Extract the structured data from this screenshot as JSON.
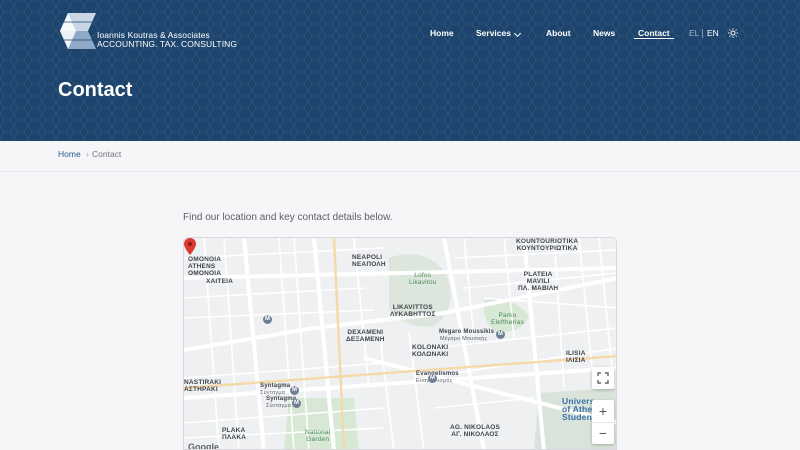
{
  "brand": {
    "name_line1": "Ioannis Koutras & Associates",
    "name_line2": "ACCOUNTING. TAX. CONSULTING"
  },
  "nav": {
    "items": [
      {
        "label": "Home"
      },
      {
        "label": "Services"
      },
      {
        "label": "About"
      },
      {
        "label": "News"
      },
      {
        "label": "Contact",
        "active": true
      }
    ],
    "lang_el": "EL",
    "lang_en": "EN",
    "theme_icon": "sun-icon"
  },
  "page": {
    "title": "Contact",
    "intro": "Find our location and key contact details below."
  },
  "breadcrumb": {
    "home": "Home",
    "separator": "›",
    "current": "Contact"
  },
  "map": {
    "labels": {
      "omonoia": "ΟΜΟΝΟΙΑ\nATHENS\nΟΜΟΝΟΙΑ",
      "xaiteia": "ΧΑΙΤΕΙΑ",
      "neapoli": "NEAPOLI\nΝΕΑΠΟΛΗ",
      "lofos": "Lofos\nLikavitou",
      "likavittos": "LIKAVITTOS\nΛΥΚΑΒΗΤΤΟΣ",
      "kountouriotika": "KOUNTOURIOTIKA\nΚΟΥΝΤΟΥΡΙΩΤΙΚΑ",
      "plateia": "PLATEIA\nMAVILI\nΠΛ. ΜΑΒΙΛΗ",
      "parko": "Parko\nEleftherias",
      "megaro": "Megaro Moussikis",
      "megaro_gr": "Μέγαρο Μουσικής",
      "dexameni": "DEXAMENI\nΔΕΞΑΜΕΝΗ",
      "kolonaki": "KOLONAKI\nΚΟΛΩΝΑΚΙ",
      "ilisia": "ILISIA\nΙΛΙΣΙΑ",
      "evangelismos": "Evangelismos",
      "evangelismos_gr": "Ευαγγελισμός",
      "syntagma": "Syntagma",
      "syntagma_gr": "Σύνταγμα",
      "syntagma2": "Syntagma",
      "syntagma2_gr": "Σύνταγμα",
      "astiriki": "NASTIRAKI\nΑΣΤΗΡΑΚΙ",
      "plaka": "PLAKA\nΠΛΑΚΑ",
      "national_garden": "National\nGarden",
      "ag_nikolaos": "AG. NIKOLAOS\nΑΓ. ΝΙΚΟΛΑΟΣ",
      "university": "Univers\nof Athe\nStudent D",
      "google": "Google"
    },
    "metro_symbol": "M",
    "zoom_in": "+",
    "zoom_out": "−"
  },
  "colors": {
    "header_bg": "#1c446c",
    "accent": "#2a5a8c",
    "pin": "#d93b30"
  }
}
